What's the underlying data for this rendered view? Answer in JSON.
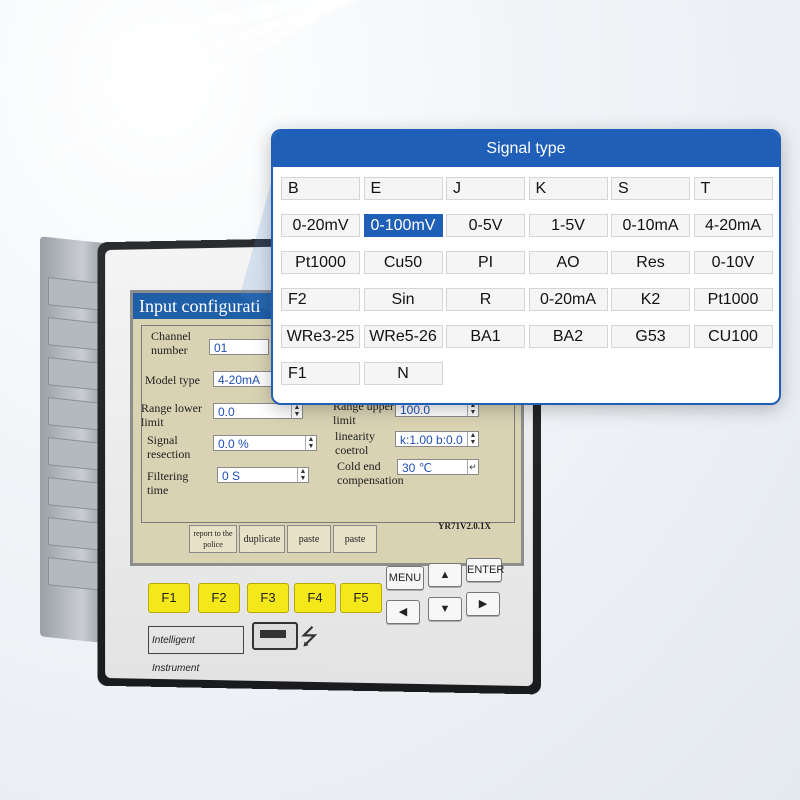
{
  "popup": {
    "title": "Signal type",
    "selected_index": 7,
    "rows": [
      [
        "B",
        "E",
        "J",
        "K",
        "S",
        "T"
      ],
      [
        "0-20mV",
        "0-100mV",
        "0-5V",
        "1-5V",
        "0-10mA",
        "4-20mA"
      ],
      [
        "Pt1000",
        "Cu50",
        "PI",
        "AO",
        "Res",
        "0-10V"
      ],
      [
        "F2",
        "Sin",
        "R",
        "0-20mA",
        "K2",
        "Pt1000"
      ],
      [
        "WRe3-25",
        "WRe5-26",
        "BA1",
        "BA2",
        "G53",
        "CU100"
      ],
      [
        "F1",
        "N"
      ]
    ]
  },
  "screen": {
    "title": "Input configurati",
    "channel_label_1": "Channel",
    "channel_label_2": "number",
    "channel_value": "01",
    "model_label": "Model type",
    "model_value": "4-20mA",
    "range_lower_label_1": "Range lower",
    "range_lower_label_2": "limit",
    "range_lower_value": "0.0",
    "range_upper_label_1": "Range upper",
    "range_upper_label_2": "limit",
    "range_upper_value": "100.0",
    "signal_label_1": "Signal",
    "signal_label_2": "resection",
    "signal_value": "0.0 %",
    "linearity_label_1": "linearity",
    "linearity_label_2": "coetrol",
    "linearity_value": "k:1.00 b:0.0",
    "filtering_label_1": "Filtering",
    "filtering_label_2": "time",
    "filtering_value": "0 S",
    "cold_end_label_1": "Cold end",
    "cold_end_label_2": "compensation",
    "cold_end_value": "30 ℃",
    "version": "YR71V2.0.1X",
    "tabs": [
      "report to the police",
      "duplicate",
      "paste",
      "paste"
    ]
  },
  "keys": {
    "function": [
      "F1",
      "F2",
      "F3",
      "F4",
      "F5"
    ],
    "menu": "MENU",
    "enter": "ENTER",
    "up": "▲",
    "left": "◀",
    "down": "▼",
    "right": "▶"
  },
  "device": {
    "brand": "Intelligent Instrument",
    "usb_symbol": "⭍"
  },
  "colors": {
    "accent": "#1f5fb8",
    "function_key": "#f4e81a",
    "screen_bg": "#d9d3b4"
  }
}
